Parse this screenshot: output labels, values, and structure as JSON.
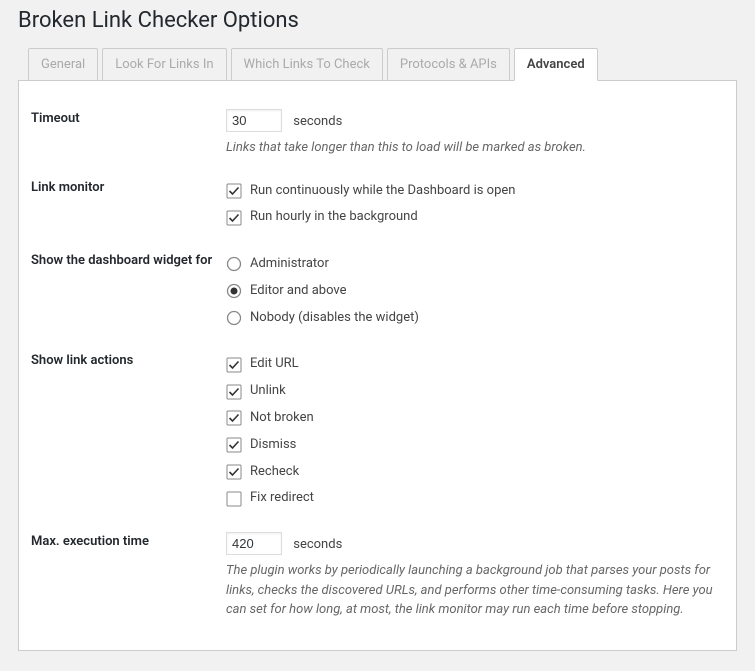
{
  "page_title": "Broken Link Checker Options",
  "tabs": [
    {
      "label": "General",
      "active": false
    },
    {
      "label": "Look For Links In",
      "active": false
    },
    {
      "label": "Which Links To Check",
      "active": false
    },
    {
      "label": "Protocols & APIs",
      "active": false
    },
    {
      "label": "Advanced",
      "active": true
    }
  ],
  "timeout": {
    "label": "Timeout",
    "value": "30",
    "unit": "seconds",
    "description": "Links that take longer than this to load will be marked as broken."
  },
  "link_monitor": {
    "label": "Link monitor",
    "options": [
      {
        "label": "Run continuously while the Dashboard is open",
        "checked": true
      },
      {
        "label": "Run hourly in the background",
        "checked": true
      }
    ]
  },
  "dashboard_widget": {
    "label": "Show the dashboard widget for",
    "options": [
      {
        "label": "Administrator",
        "selected": false
      },
      {
        "label": "Editor and above",
        "selected": true
      },
      {
        "label": "Nobody (disables the widget)",
        "selected": false
      }
    ]
  },
  "link_actions": {
    "label": "Show link actions",
    "options": [
      {
        "label": "Edit URL",
        "checked": true
      },
      {
        "label": "Unlink",
        "checked": true
      },
      {
        "label": "Not broken",
        "checked": true
      },
      {
        "label": "Dismiss",
        "checked": true
      },
      {
        "label": "Recheck",
        "checked": true
      },
      {
        "label": "Fix redirect",
        "checked": false
      }
    ]
  },
  "max_exec": {
    "label": "Max. execution time",
    "value": "420",
    "unit": "seconds",
    "description": "The plugin works by periodically launching a background job that parses your posts for links, checks the discovered URLs, and performs other time-consuming tasks. Here you can set for how long, at most, the link monitor may run each time before stopping."
  }
}
